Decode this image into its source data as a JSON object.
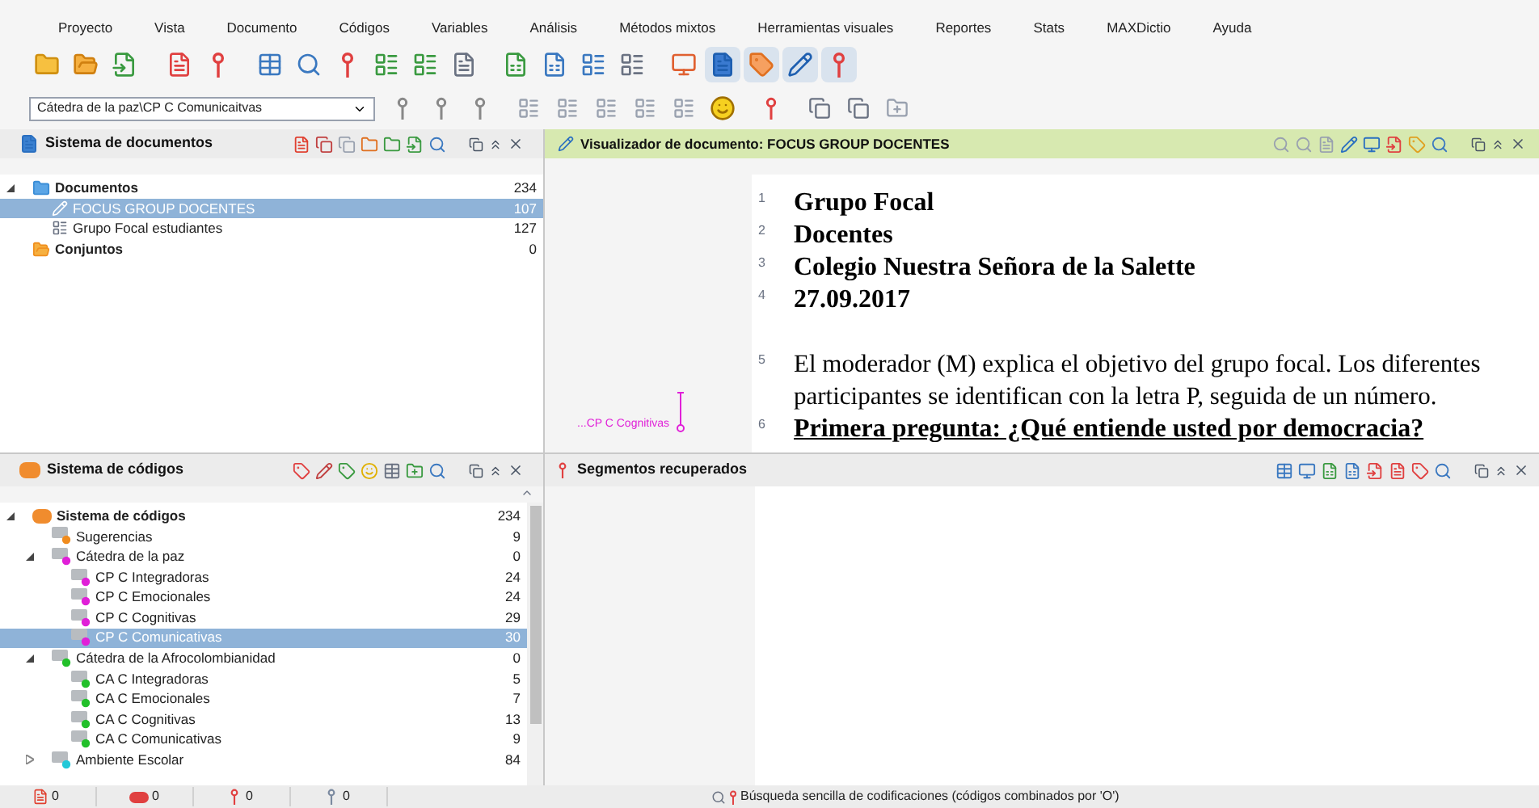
{
  "menu": [
    "Proyecto",
    "Vista",
    "Documento",
    "Códigos",
    "Variables",
    "Análisis",
    "Métodos mixtos",
    "Herramientas visuales",
    "Reportes",
    "Stats",
    "MAXDictio",
    "Ayuda"
  ],
  "code_selector": {
    "value": "Cátedra de la paz\\CP C Comunicaitvas"
  },
  "document_system": {
    "title": "Sistema de documentos",
    "tree": [
      {
        "label": "Documentos",
        "count": "234",
        "kind": "folder",
        "expanded": true,
        "selected": false,
        "children": [
          {
            "label": "FOCUS GROUP DOCENTES",
            "count": "107",
            "kind": "open-doc",
            "selected": true
          },
          {
            "label": "Grupo Focal estudiantes",
            "count": "127",
            "kind": "doc",
            "selected": false
          }
        ]
      },
      {
        "label": "Conjuntos",
        "count": "0",
        "kind": "sets",
        "selected": false
      }
    ]
  },
  "document_viewer": {
    "title": "Visualizador de documento: FOCUS GROUP DOCENTES",
    "memo_label": "...CP C Cognitivas",
    "paragraphs": [
      {
        "number": "1",
        "text": "Grupo Focal",
        "kind": "heading"
      },
      {
        "number": "2",
        "text": "Docentes",
        "kind": "heading"
      },
      {
        "number": "3",
        "text": "Colegio Nuestra Señora de la Salette",
        "kind": "heading"
      },
      {
        "number": "4",
        "text": "27.09.2017",
        "kind": "heading"
      },
      {
        "kind": "blank"
      },
      {
        "number": "5",
        "text": "El moderador (M) explica el objetivo del grupo focal. Los diferentes participantes se identifican con la letra P, seguida de un número.",
        "kind": "body"
      },
      {
        "number": "6",
        "text": "Primera pregunta: ¿Qué  entiende usted por democracia?",
        "kind": "question"
      }
    ]
  },
  "code_system": {
    "title": "Sistema de códigos",
    "tree": [
      {
        "label": "Sistema de códigos",
        "count": "234",
        "kind": "root",
        "expanded": true,
        "selected": false,
        "children": [
          {
            "label": "Sugerencias",
            "count": "9",
            "kind": "code",
            "color": "#f08c1e",
            "selected": false
          },
          {
            "label": "Cátedra de la paz",
            "count": "0",
            "kind": "code",
            "color": "#e020d8",
            "expanded": true,
            "selected": false,
            "children": [
              {
                "label": "CP C Integradoras",
                "count": "24",
                "kind": "code",
                "color": "#e020d8",
                "selected": false
              },
              {
                "label": "CP C Emocionales",
                "count": "24",
                "kind": "code",
                "color": "#e020d8",
                "selected": false
              },
              {
                "label": "CP C Cognitivas",
                "count": "29",
                "kind": "code",
                "color": "#e020d8",
                "selected": false
              },
              {
                "label": "CP C Comunicativas",
                "count": "30",
                "kind": "code",
                "color": "#e020d8",
                "selected": true
              }
            ]
          },
          {
            "label": "Cátedra de la Afrocolombianidad",
            "count": "0",
            "kind": "code",
            "color": "#22c02a",
            "expanded": true,
            "selected": false,
            "children": [
              {
                "label": "CA C Integradoras",
                "count": "5",
                "kind": "code",
                "color": "#22c02a",
                "selected": false
              },
              {
                "label": "CA C Emocionales",
                "count": "7",
                "kind": "code",
                "color": "#22c02a",
                "selected": false
              },
              {
                "label": "CA C Cognitivas",
                "count": "13",
                "kind": "code",
                "color": "#22c02a",
                "selected": false
              },
              {
                "label": "CA C Comunicativas",
                "count": "9",
                "kind": "code",
                "color": "#22c02a",
                "selected": false
              }
            ]
          },
          {
            "label": "Ambiente Escolar",
            "count": "84",
            "kind": "code",
            "color": "#22c8d8",
            "expanded": false,
            "selected": false
          }
        ]
      }
    ]
  },
  "retrieved_segments": {
    "title": "Segmentos recuperados"
  },
  "status_bar": {
    "counters": [
      {
        "value": "0",
        "kind": "documents"
      },
      {
        "value": "0",
        "kind": "codes"
      },
      {
        "value": "0",
        "kind": "segments"
      },
      {
        "value": "0",
        "kind": "weights"
      }
    ],
    "message": "Búsqueda sencilla de codificaciones (códigos combinados por 'O')"
  }
}
